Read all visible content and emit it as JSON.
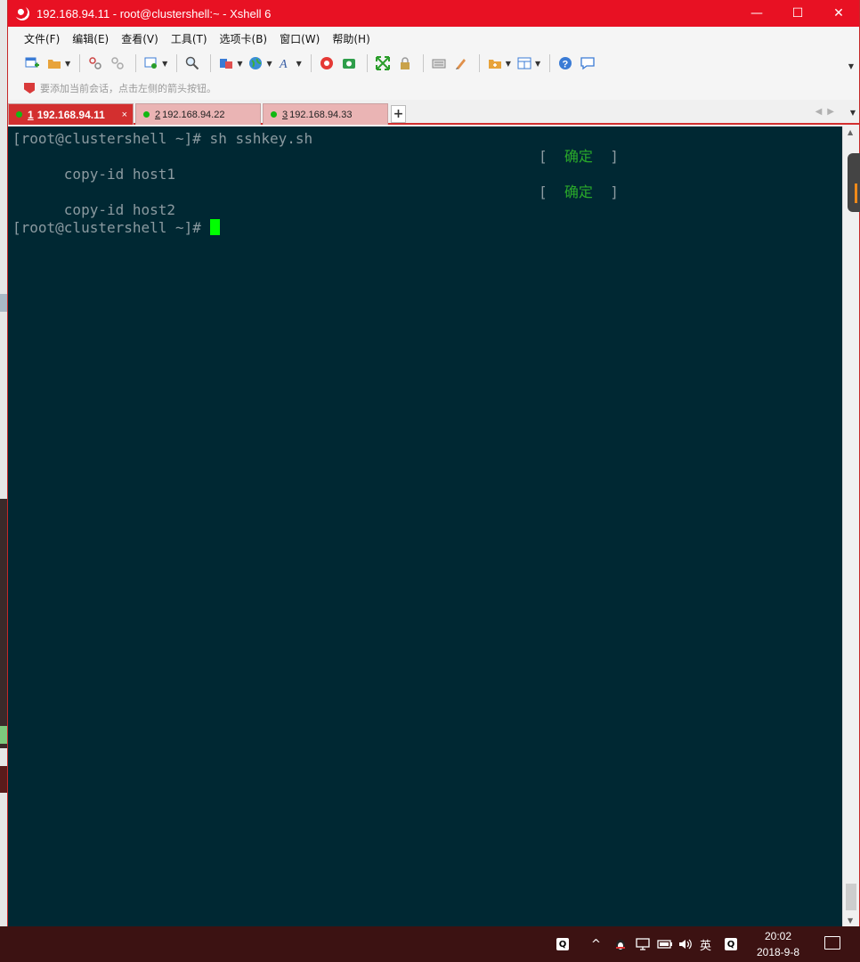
{
  "window": {
    "title": "192.168.94.11 - root@clustershell:~ - Xshell 6",
    "controls": {
      "minimize": "—",
      "maximize": "☐",
      "close": "✕"
    }
  },
  "menu": [
    "文件(F)",
    "编辑(E)",
    "查看(V)",
    "工具(T)",
    "选项卡(B)",
    "窗口(W)",
    "帮助(H)"
  ],
  "toolbar": {
    "icons": [
      "new-session-icon",
      "open-folder-icon",
      "disconnect-icon",
      "reconnect-icon",
      "properties-icon",
      "find-icon",
      "transfer-icon",
      "globe-icon",
      "font-icon",
      "xftp-icon",
      "camera-icon",
      "fullscreen-icon",
      "lock-icon",
      "keyboard-icon",
      "highlight-icon",
      "new-folder-icon",
      "layout-icon",
      "help-icon",
      "chat-icon"
    ]
  },
  "session_hint": "要添加当前会话，点击左侧的箭头按钮。",
  "tabs": [
    {
      "index": "1",
      "label": "192.168.94.11",
      "active": true
    },
    {
      "index": "2",
      "label": "192.168.94.22",
      "active": false
    },
    {
      "index": "3",
      "label": "192.168.94.33",
      "active": false
    }
  ],
  "tab_add": "+",
  "tab_close": "×",
  "terminal": {
    "lines": [
      {
        "text": "[root@clustershell ~]# sh sshkey.sh"
      },
      {
        "text": "copy-id host1",
        "status_open": "[  ",
        "status": "确定",
        "status_close": "  ]"
      },
      {
        "text": ""
      },
      {
        "text": "copy-id host2",
        "status_open": "[  ",
        "status": "确定",
        "status_close": "  ]"
      },
      {
        "text": ""
      },
      {
        "text": "[root@clustershell ~]# ",
        "cursor": true
      }
    ]
  },
  "taskbar": {
    "ime": "英",
    "time": "20:02",
    "date": "2018-9-8"
  },
  "colors": {
    "titlebar": "#e81123",
    "terminal_bg": "#002833",
    "terminal_fg": "#8b9aa0",
    "ok_green": "#2aaa2a",
    "cursor": "#00ff00",
    "taskbar": "#3c1212"
  }
}
